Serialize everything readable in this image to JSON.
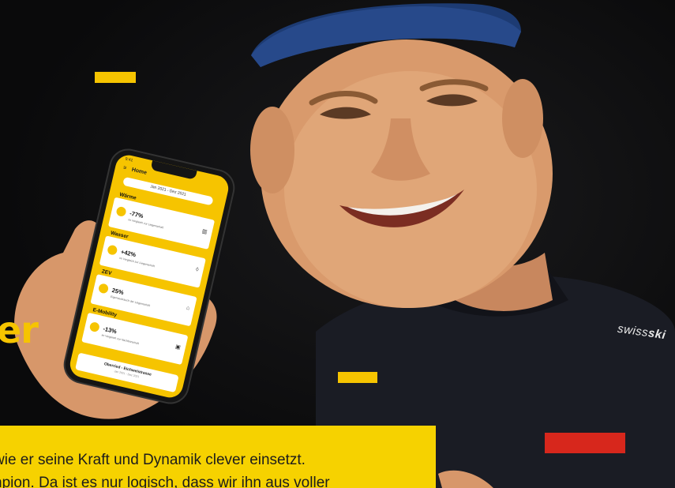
{
  "headline": "er",
  "caption_lines": [
    "wie er seine Kraft und Dynamik clever einsetzt.",
    "npion. Da ist es nur logisch, dass wir ihn aus voller"
  ],
  "phone_app": {
    "status_time": "9:41",
    "header_title": "Home",
    "date_range": "Jan 2021 - Dez 2021",
    "cards": [
      {
        "title": "Wärme",
        "value": "-77%",
        "sub": "im Vergleich zur Liegenschaft",
        "icon": "radiator-icon"
      },
      {
        "title": "Wasser",
        "value": "+42%",
        "sub": "im Vergleich zur Liegenschaft",
        "icon": "drop-icon"
      },
      {
        "title": "ZEV",
        "value": "25%",
        "sub": "Eigenverbrauch der Liegenschaft",
        "icon": "house-icon"
      },
      {
        "title": "E-Mobility",
        "value": "-13%",
        "sub": "im Vergleich zur Nachbarschaft",
        "icon": "charger-icon"
      }
    ],
    "location_title": "Oberried - Eichweistrasse",
    "location_sub": "Jan 2021 - Dez 2021"
  },
  "shirt_text": {
    "light": "swiss",
    "bold": "ski"
  },
  "colors": {
    "brand_yellow": "#f6c400",
    "caption_yellow": "#f6d200",
    "accent_red": "#d7271c",
    "background": "#0b0b0c"
  }
}
